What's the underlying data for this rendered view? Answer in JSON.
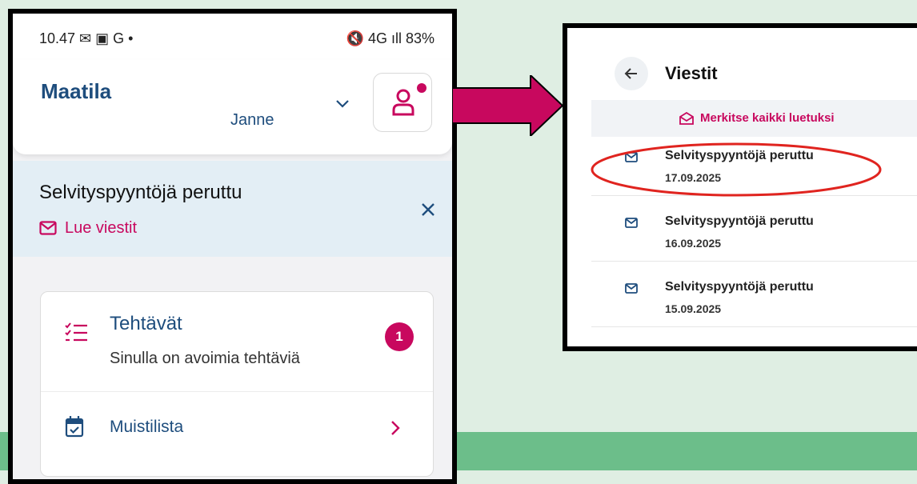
{
  "status_bar": {
    "time": "10.47 ✉ ▣ G •",
    "right": "🔇 4G ıll 83%"
  },
  "header": {
    "farm_name": "Maatila",
    "user_name": "Janne"
  },
  "notice": {
    "title": "Selvityspyyntöjä peruttu",
    "link": "Lue viestit"
  },
  "tasks": {
    "title": "Tehtävät",
    "subtitle": "Sinulla on avoimia tehtäviä",
    "badge": "1"
  },
  "memo": {
    "label": "Muistilista"
  },
  "messages": {
    "title": "Viestit",
    "mark_all": "Merkitse kaikki luetuksi",
    "items": [
      {
        "title": "Selvityspyyntöjä peruttu",
        "date": "17.09.2025"
      },
      {
        "title": "Selvityspyyntöjä peruttu",
        "date": "16.09.2025"
      },
      {
        "title": "Selvityspyyntöjä peruttu",
        "date": "15.09.2025"
      }
    ]
  },
  "colors": {
    "accent": "#c8085e",
    "primary": "#1e4d7d",
    "notice_bg": "#e3eef5",
    "highlight": "#e0241f",
    "page_bg": "#dfeee3",
    "band": "#6cbe8a"
  },
  "icons": [
    "chevron-down-icon",
    "profile-icon",
    "mail-icon",
    "close-icon",
    "checklist-icon",
    "calendar-check-icon",
    "chevron-right-icon",
    "back-arrow-icon",
    "mail-open-icon"
  ]
}
